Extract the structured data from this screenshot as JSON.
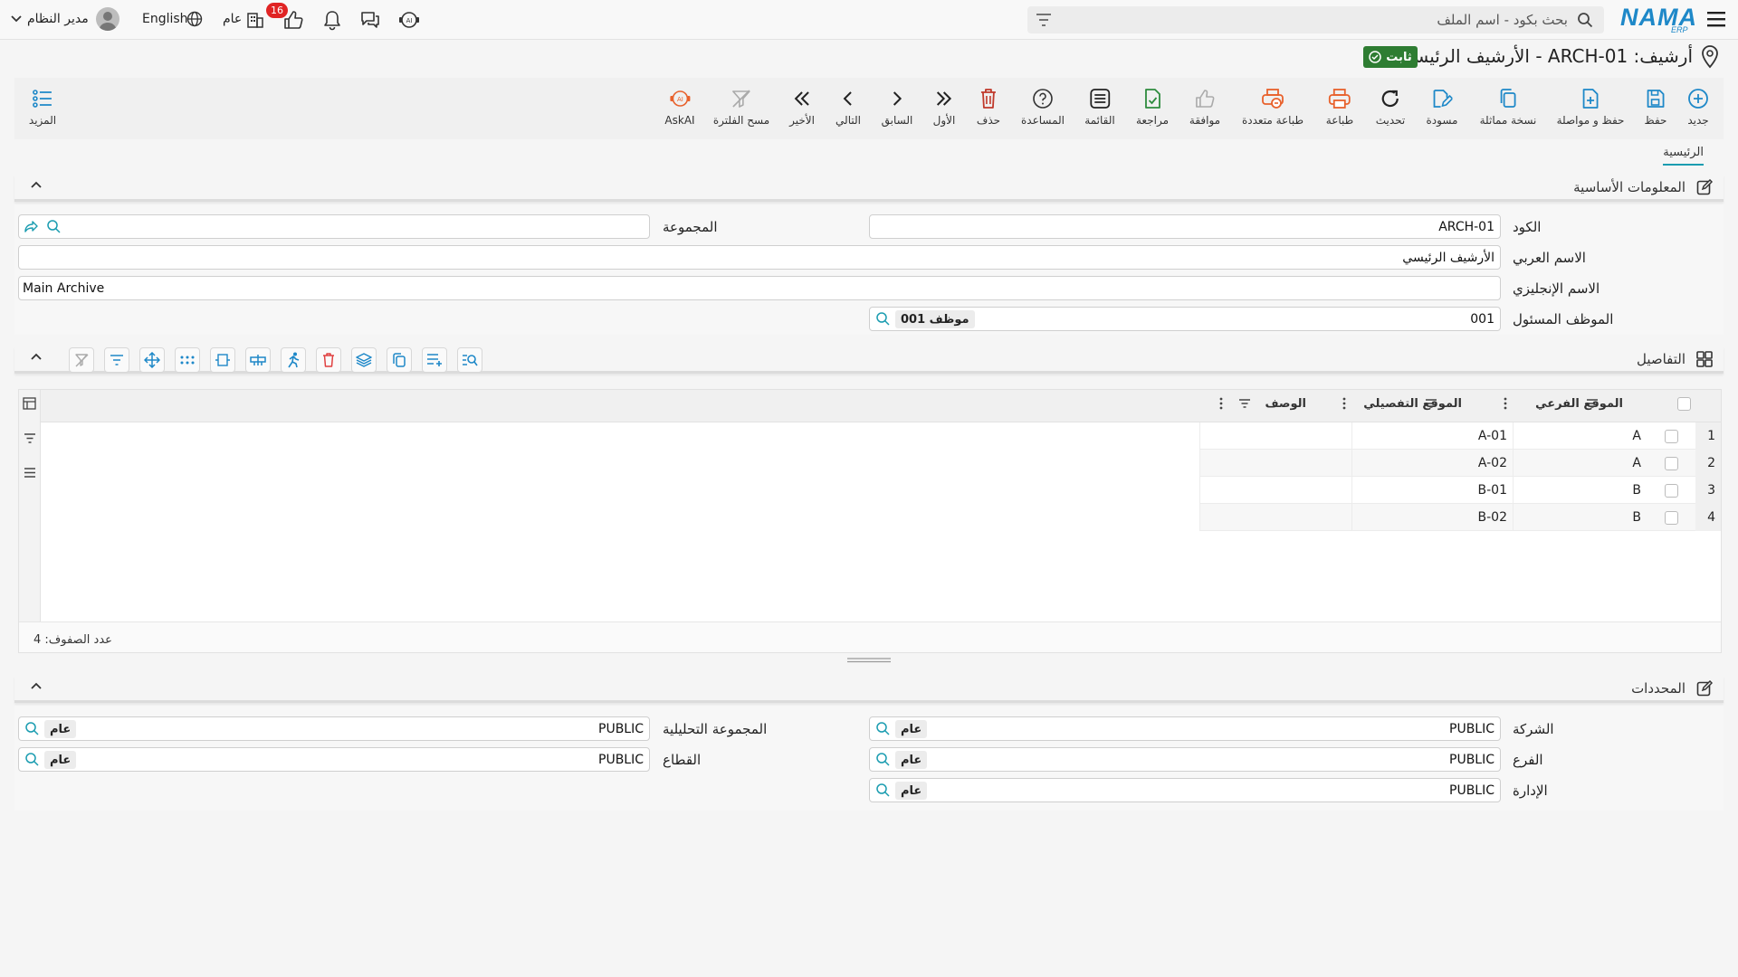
{
  "topbar": {
    "brand_main": "NAMA",
    "brand_sub": "ERP",
    "search_placeholder": "بحث بكود - اسم الملف",
    "user_name": "مدير النظام",
    "language": "English",
    "scope": "عام",
    "notif_count": "16"
  },
  "page": {
    "title": "أرشيف: ARCH-01 - الأرشيف الرئيسي",
    "status": "ثابت"
  },
  "toolbar": {
    "new": "جديد",
    "save": "حفظ",
    "save_continue": "حفظ و مواصلة",
    "duplicate": "نسخة مماثلة",
    "draft": "مسودة",
    "refresh": "تحديث",
    "print": "طباعة",
    "multi_print": "طباعة متعددة",
    "approve": "موافقة",
    "review": "مراجعة",
    "list": "القائمة",
    "help": "المساعدة",
    "delete": "حذف",
    "first": "الأول",
    "previous": "السابق",
    "next": "التالي",
    "last": "الأخير",
    "clear_filter": "مسح الفلترة",
    "askai": "AskAI",
    "more": "المزيد"
  },
  "tabs": {
    "main": "الرئيسية"
  },
  "basic": {
    "title": "المعلومات الأساسية",
    "code_label": "الكود",
    "code_value": "ARCH-01",
    "arabic_name_label": "الاسم العربي",
    "arabic_name_value": "الأرشيف الرئيسي",
    "english_name_label": "الاسم الإنجليزي",
    "english_name_value": "Main Archive",
    "employee_label": "الموظف المسئول",
    "employee_code": "001",
    "employee_name": "موظف 001",
    "group_label": "المجموعة",
    "group_value": ""
  },
  "details": {
    "title": "التفاصيل",
    "columns": {
      "sub_location": "الموقع الفرعي",
      "detail_location": "الموقع التفصيلي",
      "description": "الوصف"
    },
    "rows": [
      {
        "n": "1",
        "sub": "A",
        "detail": "A-01",
        "desc": ""
      },
      {
        "n": "2",
        "sub": "A",
        "detail": "A-02",
        "desc": ""
      },
      {
        "n": "3",
        "sub": "B",
        "detail": "B-01",
        "desc": ""
      },
      {
        "n": "4",
        "sub": "B",
        "detail": "B-02",
        "desc": ""
      }
    ],
    "row_count_label": "عدد الصفوف: 4"
  },
  "dims": {
    "title": "المحددات",
    "company_label": "الشركة",
    "company_code": "PUBLIC",
    "company_name": "عام",
    "branch_label": "الفرع",
    "branch_code": "PUBLIC",
    "branch_name": "عام",
    "dept_label": "الإدارة",
    "dept_code": "PUBLIC",
    "dept_name": "عام",
    "analytic_label": "المجموعة التحليلية",
    "analytic_code": "PUBLIC",
    "analytic_name": "عام",
    "sector_label": "القطاع",
    "sector_code": "PUBLIC",
    "sector_name": "عام"
  },
  "colors": {
    "accent": "#1a9cb0",
    "blue_icon": "#1e88c8",
    "print_icon": "#e8612c",
    "delete_icon": "#c0392b",
    "status_green": "#2e7d32"
  }
}
